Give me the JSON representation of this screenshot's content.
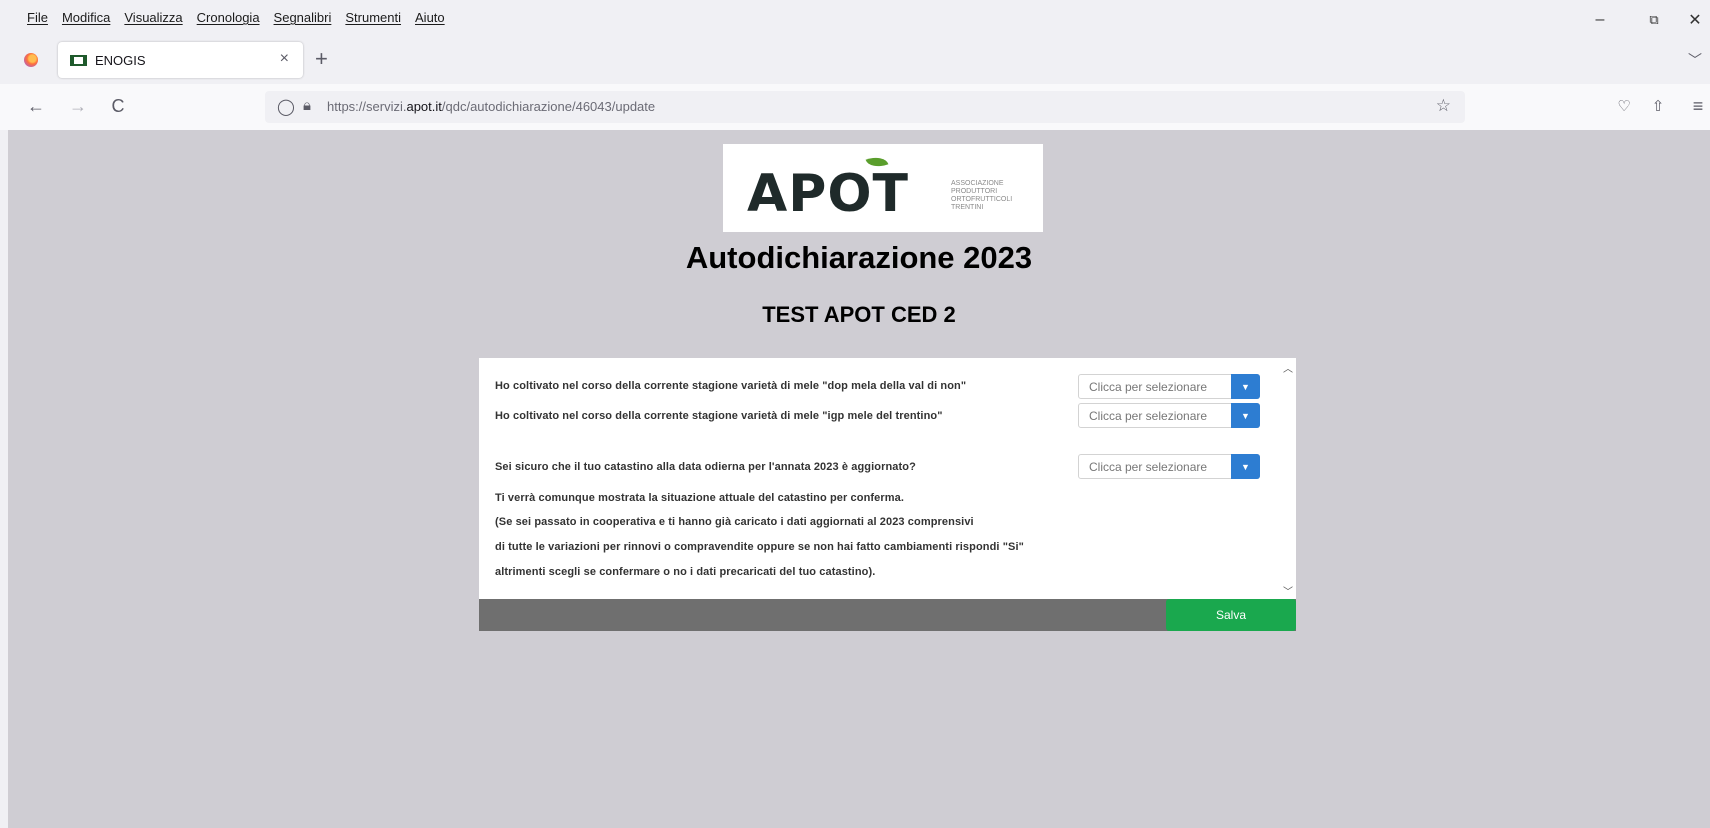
{
  "menubar": {
    "items": [
      "File",
      "Modifica",
      "Visualizza",
      "Cronologia",
      "Segnalibri",
      "Strumenti",
      "Aiuto"
    ]
  },
  "window_controls": {
    "minimize": "–",
    "restore": "⧉",
    "close": "✕"
  },
  "tab": {
    "title": "ENOGIS",
    "close": "×",
    "new_tab": "+"
  },
  "nav": {
    "back": "←",
    "forward": "→",
    "reload": "C",
    "url_prefix": "https://servizi.",
    "url_domain": "apot.it",
    "url_path": "/qdc/autodichiarazione/46043/update"
  },
  "logo": {
    "word": "APOT",
    "subtitle_lines": [
      "ASSOCIAZIONE",
      "PRODUTTORI",
      "ORTOFRUTTICOLI",
      "TRENTINI"
    ]
  },
  "page": {
    "title": "Autodichiarazione 2023",
    "subtitle": "TEST APOT CED 2"
  },
  "form": {
    "questions": [
      {
        "text": "Ho coltivato nel corso della corrente stagione varietà di mele \"dop mela della val di non\"",
        "select_placeholder": "Clicca per selezionare"
      },
      {
        "text": "Ho coltivato nel corso della corrente stagione varietà di mele \"igp mele del trentino\"",
        "select_placeholder": "Clicca per selezionare"
      },
      {
        "text": "Sei sicuro che il tuo catastino alla data odierna per l'annata 2023 è aggiornato?",
        "select_placeholder": "Clicca per selezionare"
      }
    ],
    "note_lines": [
      "Ti verrà comunque mostrata la situazione attuale del catastino per conferma.",
      "(Se sei passato in cooperativa e ti hanno già caricato i dati aggiornati al 2023 comprensivi",
      "di tutte le variazioni per rinnovi o compravendite oppure se non hai fatto cambiamenti rispondi \"Si\"",
      "altrimenti scegli se confermare o no i dati precaricati del tuo catastino)."
    ],
    "save_label": "Salva"
  }
}
